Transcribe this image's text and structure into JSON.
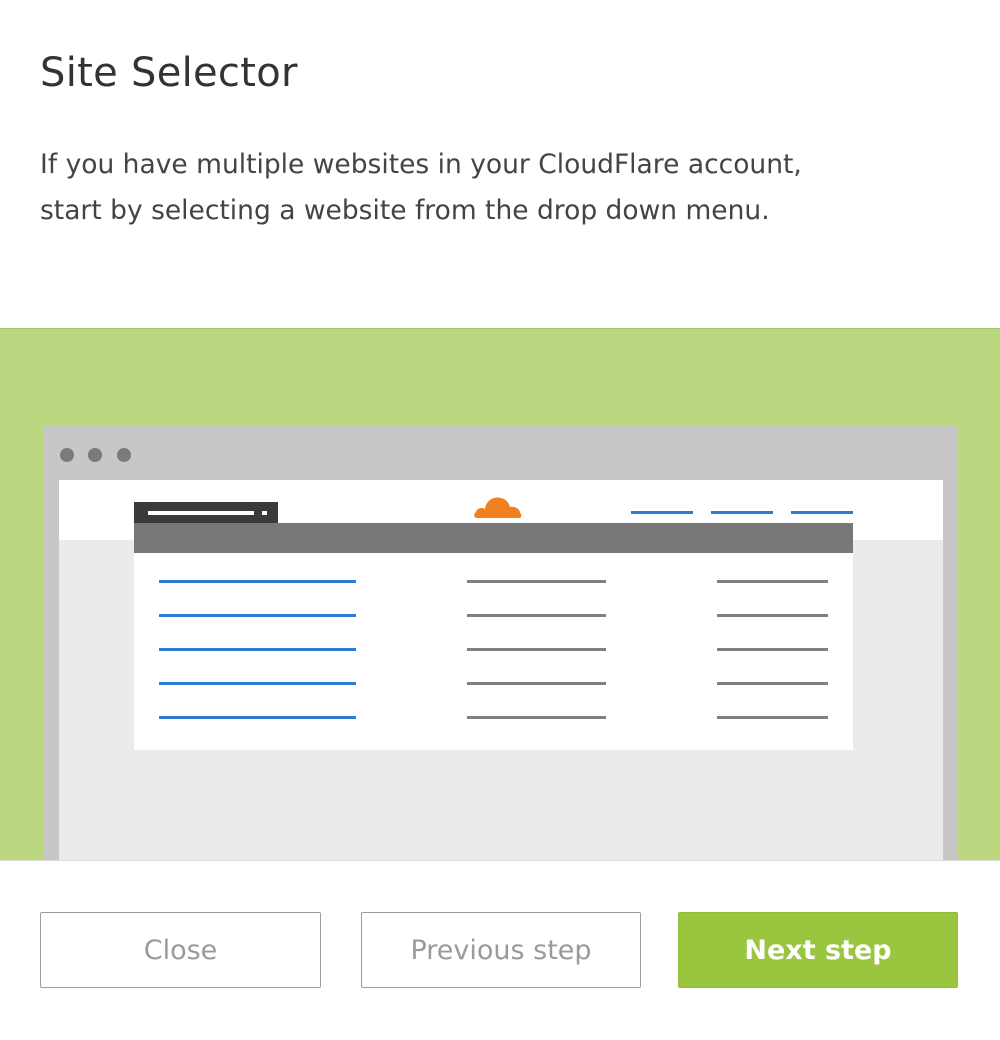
{
  "dialog": {
    "title": "Site Selector",
    "description_lines": [
      "If you have multiple websites in your CloudFlare account,",
      "start by selecting a website from the drop down menu."
    ]
  },
  "illustration": {
    "background_color": "#bbd880",
    "logo_color": "#f38020",
    "link_color": "#2b7ed1",
    "row_count": 5
  },
  "buttons": {
    "close_label": "Close",
    "previous_label": "Previous step",
    "next_label": "Next step",
    "next_color": "#99c53f"
  }
}
